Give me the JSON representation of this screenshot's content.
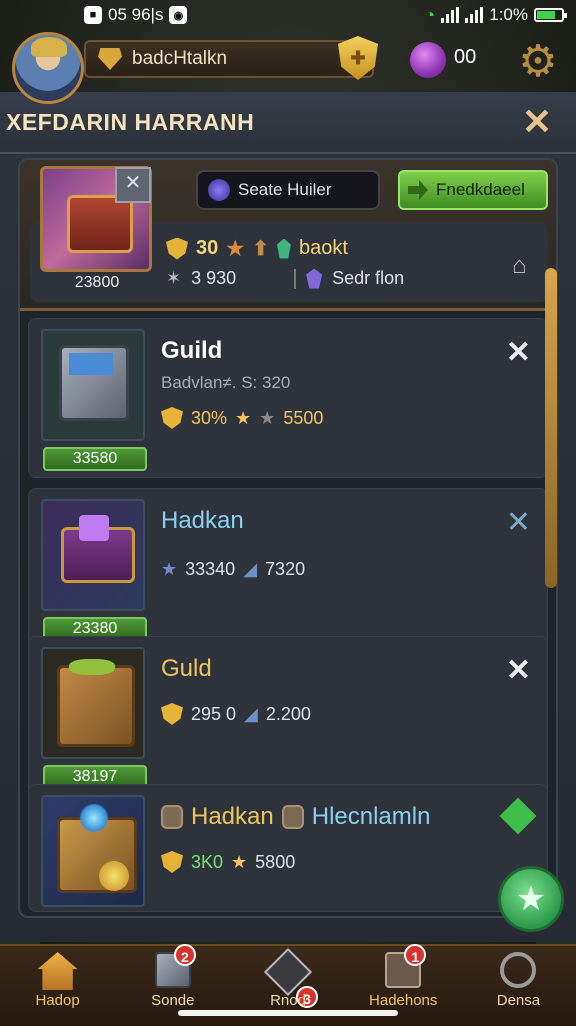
{
  "status": {
    "time": "05 96|s",
    "battery_text": "1:0%",
    "battery_level": 0.75,
    "icons": [
      "notification-icon",
      "game-icon",
      "wifi-icon",
      "signal-icon",
      "battery-icon"
    ]
  },
  "header": {
    "player_name": "badcHtalkn",
    "currency_count": "00",
    "icons": [
      "avatar",
      "crest-icon",
      "rank-shield-icon",
      "gem-icon",
      "gear-icon"
    ]
  },
  "panel": {
    "title": "XEFDARIN HARRANH",
    "close": "✕"
  },
  "featured": {
    "id_label": "23800",
    "search_label": "Seate Huiler",
    "action_label": "Fnedkdaeel",
    "stat1_value": "30",
    "stat1_text": "baokt",
    "stat2_value": "3 930",
    "stat2_text": "Sedr flon"
  },
  "items": [
    {
      "title": "Guild",
      "subtitle": "Badvlan≠. S: 320",
      "stat_a": "30%",
      "stat_b": "5500",
      "id_label": "33580",
      "close": "✕"
    },
    {
      "title": "Hadkan",
      "subtitle": "",
      "stat_a": "33340",
      "stat_b": "7320",
      "id_label": "23380",
      "close": "✕"
    },
    {
      "title": "Guld",
      "subtitle": "",
      "stat_a": "295 0",
      "stat_b": "2.200",
      "id_label": "38197",
      "close": "✕"
    },
    {
      "title": "Hadkan",
      "title2": "Hlecnlamln",
      "stat_a": "3K0",
      "stat_b": "5800"
    }
  ],
  "nav": {
    "items": [
      {
        "label": "Hadop",
        "badge": ""
      },
      {
        "label": "Sonde",
        "badge": "2"
      },
      {
        "label": "Rnod",
        "badge": "3"
      },
      {
        "label": "Hadehons",
        "badge": "1"
      },
      {
        "label": "Densa",
        "badge": ""
      }
    ]
  },
  "colors": {
    "accent_gold": "#f5c45a",
    "panel": "#2e333b",
    "green_action": "#3f8d22"
  }
}
